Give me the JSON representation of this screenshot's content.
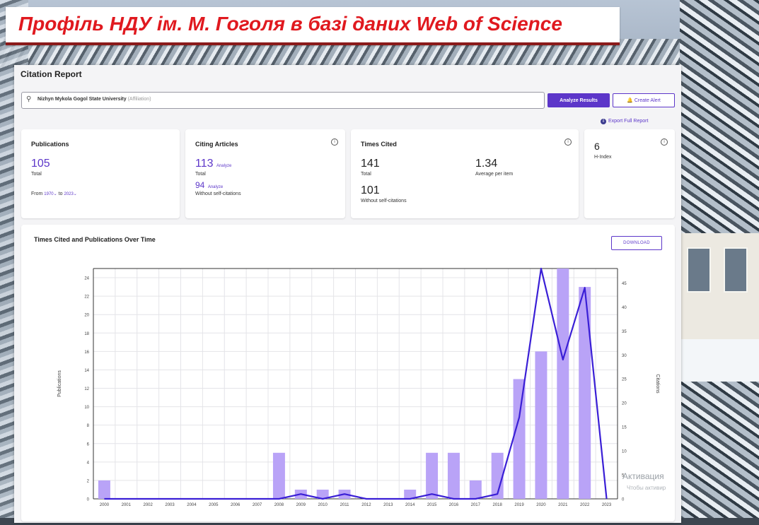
{
  "banner": {
    "title": "Профіль НДУ ім. М. Гоголя в базі даних Web of Science"
  },
  "report": {
    "heading": "Citation Report",
    "search": {
      "value": "Nizhyn Mykola Gogol State University",
      "tag": "(Affiliation)"
    },
    "analyze_button": "Analyze Results",
    "alert_button": "Create Alert",
    "export_link": "Export Full Report"
  },
  "cards": {
    "publications": {
      "title": "Publications",
      "value": "105",
      "sub": "Total",
      "from_label": "From",
      "from_value": "1970",
      "to_label": "to",
      "to_value": "2023"
    },
    "citing": {
      "title": "Citing Articles",
      "value": "113",
      "value_link": "Analyze",
      "value_sub": "Total",
      "value2": "94",
      "value2_link": "Analyze",
      "value2_sub": "Without self-citations"
    },
    "times_cited": {
      "title": "Times Cited",
      "value": "141",
      "value_sub": "Total",
      "avg": "1.34",
      "avg_sub": "Average per item",
      "value2": "101",
      "value2_sub": "Without self-citations"
    },
    "hindex": {
      "value": "6",
      "sub": "H-Index"
    }
  },
  "chart_section": {
    "title": "Times Cited and Publications Over Time",
    "download": "DOWNLOAD"
  },
  "watermark": {
    "line1": "Активация",
    "line2": "Чтобы активир"
  },
  "colors": {
    "accent": "#5c36c9",
    "bar": "#b9a3f7",
    "line": "#3a1fd6",
    "banner_text": "#e0191f"
  },
  "chart_data": {
    "type": "bar",
    "title": "Times Cited and Publications Over Time",
    "categories": [
      "2000",
      "2001",
      "2002",
      "2003",
      "2004",
      "2005",
      "2006",
      "2007",
      "2008",
      "2009",
      "2010",
      "2011",
      "2012",
      "2013",
      "2014",
      "2015",
      "2016",
      "2017",
      "2018",
      "2019",
      "2020",
      "2021",
      "2022",
      "2023"
    ],
    "series": [
      {
        "name": "Publications",
        "kind": "bar",
        "axis": "left",
        "values": [
          2,
          0,
          0,
          0,
          0,
          0,
          0,
          0,
          5,
          1,
          1,
          1,
          0,
          0,
          1,
          5,
          5,
          2,
          5,
          13,
          16,
          25,
          23,
          0
        ]
      },
      {
        "name": "Citations",
        "kind": "line",
        "axis": "right",
        "values": [
          0,
          0,
          0,
          0,
          0,
          0,
          0,
          0,
          0,
          1,
          0,
          1,
          0,
          0,
          0,
          1,
          0,
          0,
          1,
          17,
          48,
          29,
          44,
          0
        ]
      }
    ],
    "ylabel": "Publications",
    "y2label": "Citations",
    "ylim": [
      0,
      25
    ],
    "y2lim": [
      0,
      48
    ],
    "yticks": [
      0,
      2,
      4,
      6,
      8,
      10,
      12,
      14,
      16,
      18,
      20,
      22,
      24
    ],
    "y2ticks": [
      0,
      5,
      10,
      15,
      20,
      25,
      30,
      35,
      40,
      45
    ],
    "grid": true
  }
}
